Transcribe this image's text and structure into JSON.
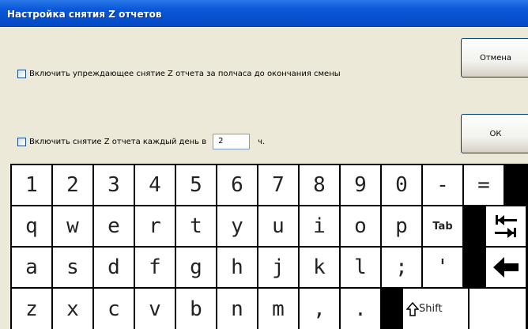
{
  "window": {
    "title": "Настройка снятия Z отчетов"
  },
  "options": {
    "early_close": {
      "label": "Включить упреждающее снятие Z отчета за полчаса до окончания смены",
      "checked": false
    },
    "daily": {
      "label": "Включить снятие Z отчета каждый день в",
      "checked": false,
      "hour_value": "2",
      "unit": "ч."
    }
  },
  "buttons": {
    "cancel": "Отмена",
    "ok": "ОК"
  },
  "keyboard": {
    "row1": [
      "1",
      "2",
      "3",
      "4",
      "5",
      "6",
      "7",
      "8",
      "9",
      "0",
      "-",
      "="
    ],
    "row2": [
      "q",
      "w",
      "e",
      "r",
      "t",
      "y",
      "u",
      "i",
      "o",
      "p",
      "Tab"
    ],
    "row3": [
      "a",
      "s",
      "d",
      "f",
      "g",
      "h",
      "j",
      "k",
      "l",
      ";",
      "'"
    ],
    "row4": [
      "z",
      "x",
      "c",
      "v",
      "b",
      "n",
      "m",
      ",",
      "."
    ],
    "shift_label": "Shift",
    "tab_icon": "tab-arrows-icon",
    "backspace_icon": "backspace-arrow-icon",
    "shift_icon": "shift-arrow-icon"
  }
}
